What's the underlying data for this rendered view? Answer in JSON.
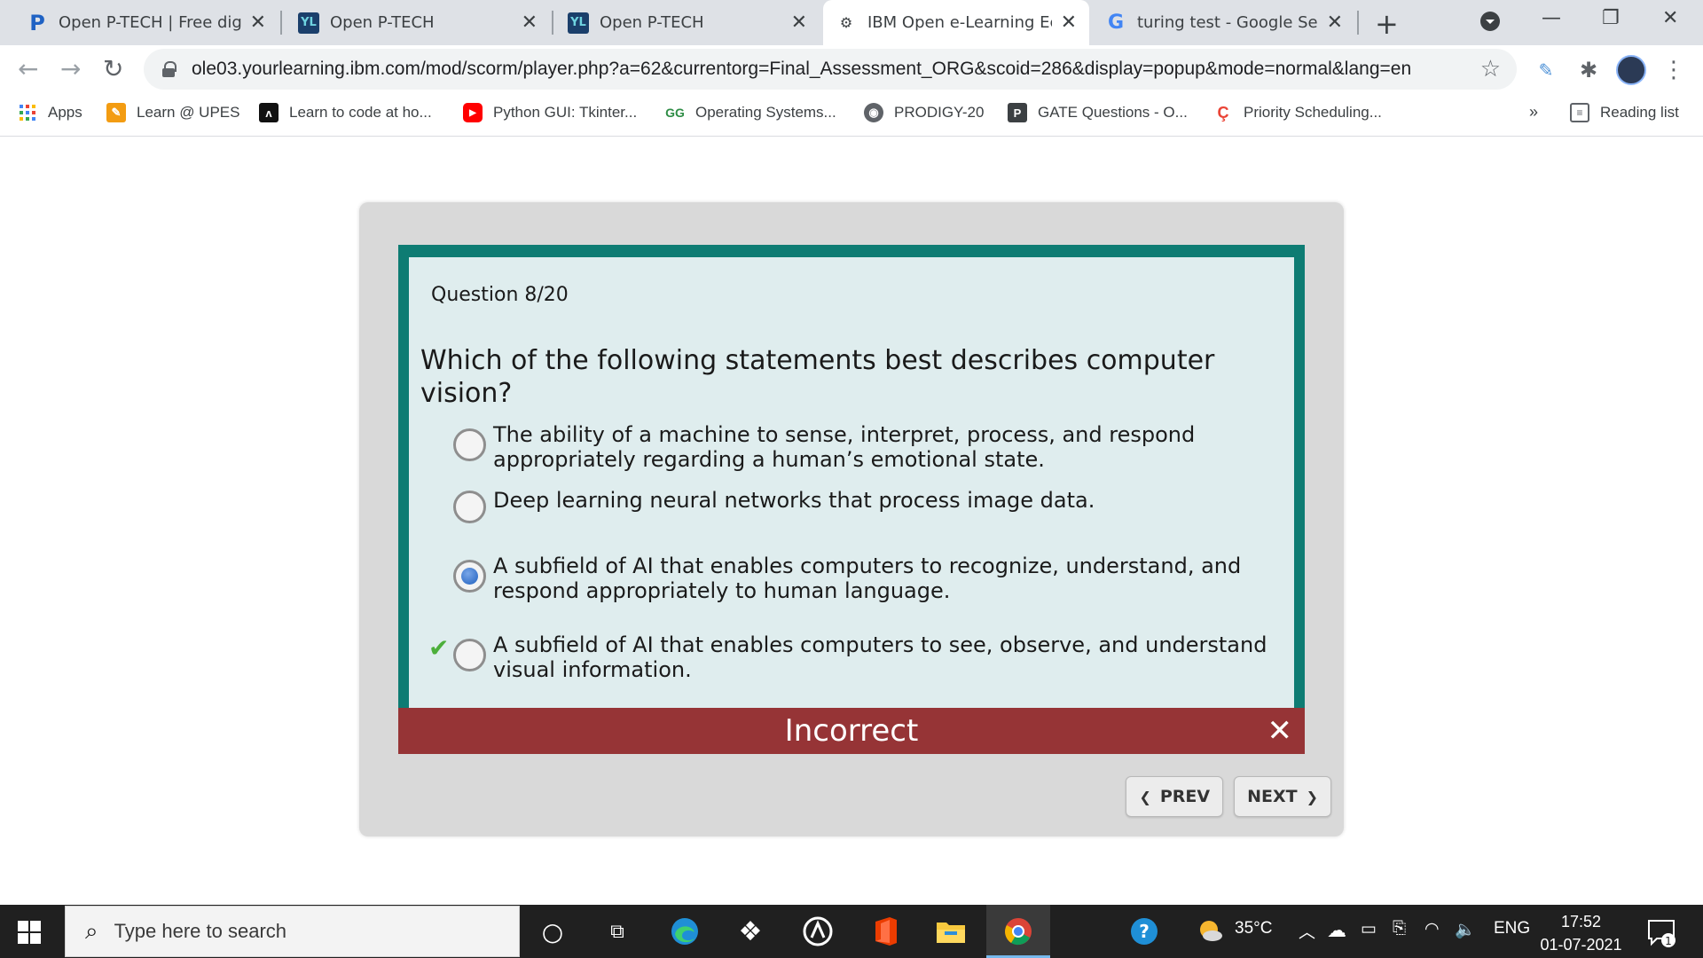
{
  "browser": {
    "tabs": [
      {
        "title": "Open P-TECH | Free digita",
        "icon": "ptech-logo-icon"
      },
      {
        "title": "Open P-TECH",
        "icon": "yl-logo-icon"
      },
      {
        "title": "Open P-TECH",
        "icon": "yl-logo-icon"
      },
      {
        "title": "IBM Open e-Learning Eco",
        "icon": "ibm-elearning-icon",
        "active": true
      },
      {
        "title": "turing test - Google Searc",
        "icon": "google-icon"
      }
    ],
    "close_glyph": "✕",
    "new_tab_glyph": "+",
    "url": "ole03.yourlearning.ibm.com/mod/scorm/player.php?a=62&currentorg=Final_Assessment_ORG&scoid=286&display=popup&mode=normal&lang=en",
    "bookmarks": [
      {
        "label": "Apps",
        "icon": "apps-grid-icon"
      },
      {
        "label": "Learn @ UPES",
        "icon": "pencil-bookmark-icon"
      },
      {
        "label": "Learn to code at ho...",
        "icon": "code-bookmark-icon"
      },
      {
        "label": "Python GUI: Tkinter...",
        "icon": "youtube-icon"
      },
      {
        "label": "Operating Systems...",
        "icon": "geeksforgeeks-icon"
      },
      {
        "label": "PRODIGY-20",
        "icon": "globe-icon"
      },
      {
        "label": "GATE Questions - O...",
        "icon": "p-bookmark-icon"
      },
      {
        "label": "Priority Scheduling...",
        "icon": "priority-bookmark-icon"
      }
    ],
    "overflow_glyph": "»",
    "reading_list": "Reading list"
  },
  "quiz": {
    "question_number": "Question 8/20",
    "question": "Which of the following statements best describes computer vision?",
    "options": [
      {
        "text": "The ability of a machine to sense, interpret, process, and respond appropriately regarding a human’s emotional state.",
        "selected": false,
        "correct": false
      },
      {
        "text": "Deep learning neural networks that process image data.",
        "selected": false,
        "correct": false
      },
      {
        "text": "A subfield of AI that enables computers to recognize, understand, and respond appropriately to human language.",
        "selected": true,
        "correct": false
      },
      {
        "text": "A subfield of AI that enables computers to see, observe, and understand visual information.",
        "selected": false,
        "correct": true
      }
    ],
    "feedback": "Incorrect",
    "feedback_close": "✕",
    "prev_label": "PREV",
    "next_label": "NEXT",
    "colors": {
      "frame": "#0e7c73",
      "card": "#dfedee",
      "feedback_bg": "#963436",
      "correct_check": "#4caf3a"
    }
  },
  "taskbar": {
    "search_placeholder": "Type here to search",
    "weather": "35°C",
    "language": "ENG",
    "time": "17:52",
    "date": "01-07-2021",
    "notification_count": "1"
  }
}
